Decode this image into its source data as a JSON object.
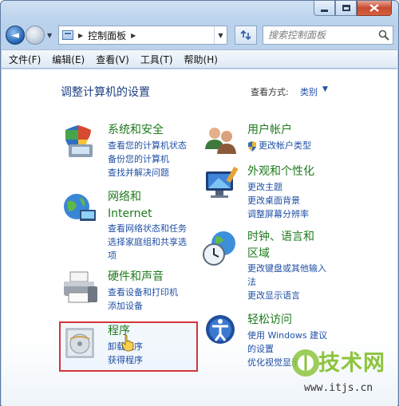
{
  "nav": {
    "breadcrumb": "控制面板",
    "search_placeholder": "搜索控制面板"
  },
  "menu": [
    "文件(F)",
    "编辑(E)",
    "查看(V)",
    "工具(T)",
    "帮助(H)"
  ],
  "content": {
    "title": "调整计算机的设置",
    "view_by_label": "查看方式:",
    "view_by_value": "类别"
  },
  "categories": {
    "system": {
      "title": "系统和安全",
      "links": [
        "查看您的计算机状态",
        "备份您的计算机",
        "查找并解决问题"
      ]
    },
    "user": {
      "title": "用户帐户",
      "links": [
        "更改帐户类型"
      ]
    },
    "appearance": {
      "title": "外观和个性化",
      "links": [
        "更改主题",
        "更改桌面背景",
        "调整屏幕分辨率"
      ]
    },
    "network": {
      "title_line1": "网络和",
      "title_line2": "Internet",
      "links": [
        "查看网络状态和任务",
        "选择家庭组和共享选",
        "项"
      ]
    },
    "clock": {
      "title_line1": "时钟、语言和",
      "title_line2": "区域",
      "links": [
        "更改键盘或其他输入",
        "法",
        "更改显示语言"
      ]
    },
    "hardware": {
      "title": "硬件和声音",
      "links": [
        "查看设备和打印机",
        "添加设备"
      ]
    },
    "ease": {
      "title": "轻松访问",
      "links": [
        "使用 Windows 建议",
        "的设置",
        "优化视觉显示"
      ]
    },
    "programs": {
      "title": "程序",
      "links": [
        "卸载程序",
        "获得程序"
      ]
    }
  },
  "watermark": {
    "text": "技术网",
    "url": "www.itjs.cn"
  }
}
